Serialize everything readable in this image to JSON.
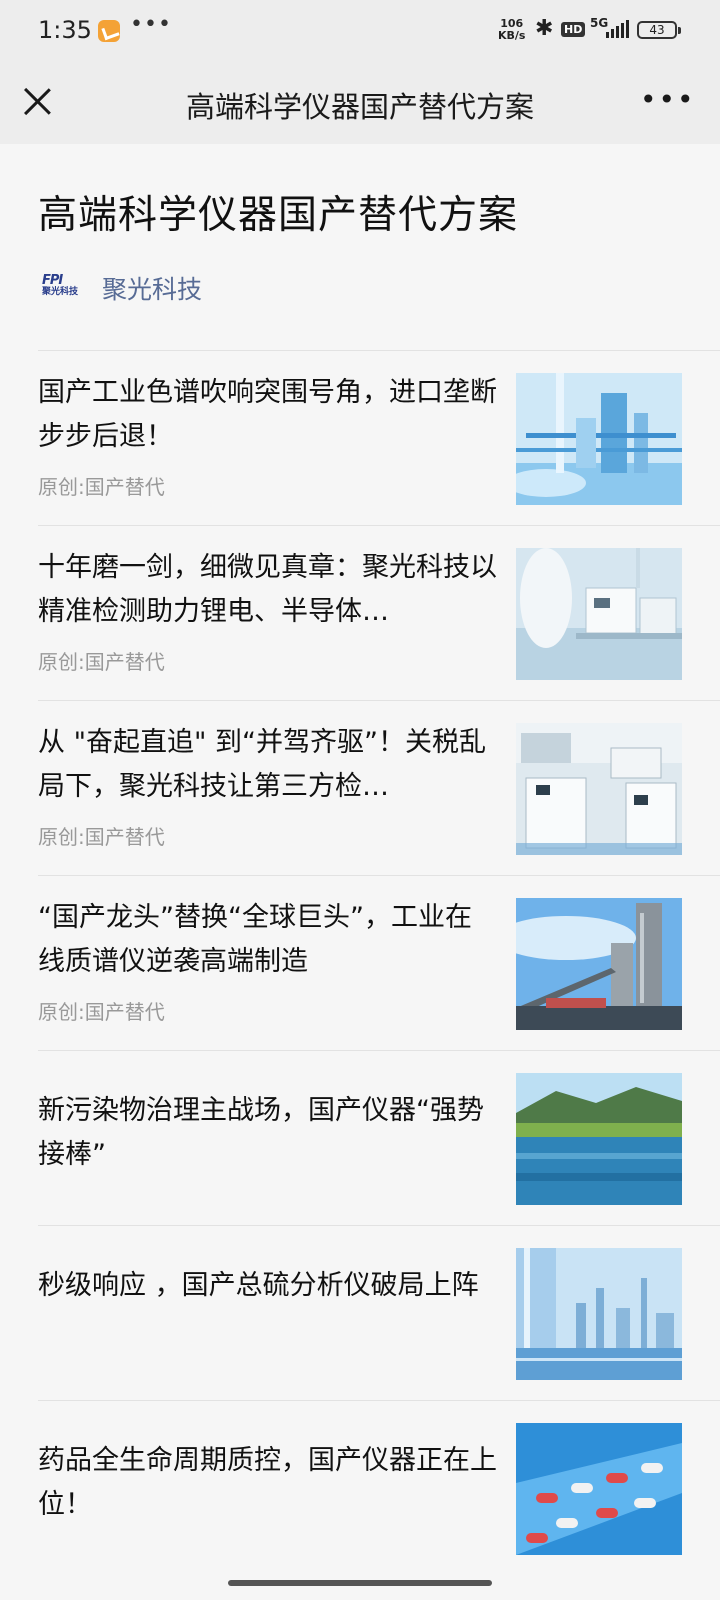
{
  "status_bar": {
    "time": "1:35",
    "speed_value": "106",
    "speed_unit": "KB/s",
    "hd_label": "HD",
    "network_label": "5G",
    "battery": "43"
  },
  "navbar": {
    "title": "高端科学仪器国产替代方案"
  },
  "page": {
    "title": "高端科学仪器国产替代方案",
    "account_name": "聚光科技",
    "account_logo_text": "FPI",
    "account_logo_subtext": "聚光科技"
  },
  "articles": [
    {
      "title": "国产工业色谱吹响突围号角，进口垄断步步后退！",
      "tag": "原创:国产替代",
      "thumb": "industrial-plant"
    },
    {
      "title": "十年磨一剑，细微见真章：聚光科技以精准检测助力锂电、半导体…",
      "tag": "原创:国产替代",
      "thumb": "lab-instruments"
    },
    {
      "title": "从 \"奋起直追\" 到“并驾齐驱”！关税乱局下，聚光科技让第三方检…",
      "tag": "原创:国产替代",
      "thumb": "lab-bench"
    },
    {
      "title": "“国产龙头”替换“全球巨头”，工业在线质谱仪逆袭高端制造",
      "tag": "原创:国产替代",
      "thumb": "factory-tower"
    },
    {
      "title": "新污染物治理主战场，国产仪器“强势接棒”",
      "tag": "",
      "thumb": "lake-landscape"
    },
    {
      "title": "秒级响应 ，国产总硫分析仪破局上阵",
      "tag": "",
      "thumb": "city-refinery"
    },
    {
      "title": "药品全生命周期质控，国产仪器正在上位！",
      "tag": "",
      "thumb": "pills-conveyor"
    }
  ],
  "colors": {
    "background": "#ededed",
    "content_background": "#f6f6f6",
    "account_name": "#576b95",
    "tag_text": "#999999",
    "logo_blue": "#2a3e8c"
  }
}
